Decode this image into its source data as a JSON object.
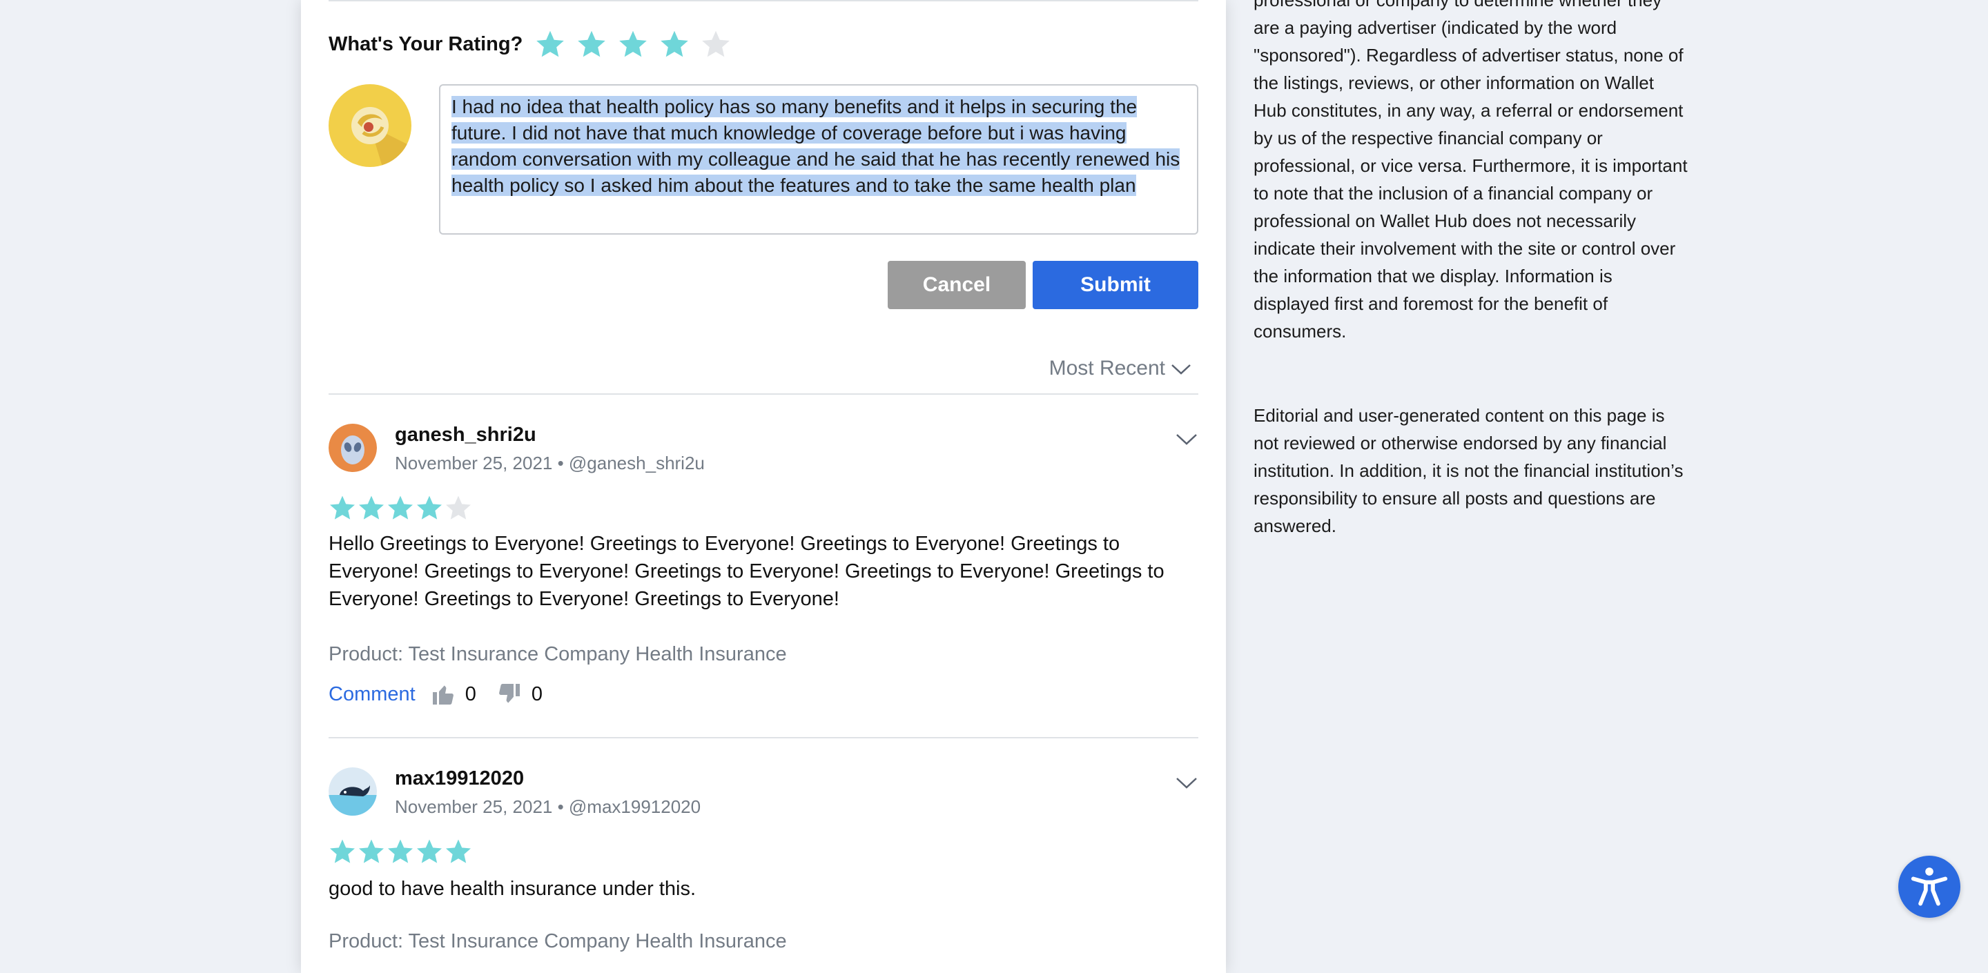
{
  "colors": {
    "star_filled": "#6fd6d9",
    "star_empty": "#e3e5e8",
    "primary": "#2b6ae0",
    "cancel": "#9c9c9c",
    "muted_text": "#737b85"
  },
  "rating_form": {
    "label": "What's Your Rating?",
    "selected_stars": 4,
    "max_stars": 5,
    "review_text": "I had no idea that health policy has so many benefits and it helps in securing the future. I did not have that much knowledge of coverage before but i was having random conversation with my colleague and he said that he has recently renewed his health policy so I asked him about the features and to take the same health plan",
    "cancel_label": "Cancel",
    "submit_label": "Submit"
  },
  "sort": {
    "label": "Most Recent"
  },
  "reviews": [
    {
      "username": "ganesh_shri2u",
      "date": "November 25, 2021",
      "handle": "@ganesh_shri2u",
      "meta": "November 25, 2021 • @ganesh_shri2u",
      "stars": 4,
      "text": "Hello Greetings to Everyone! Greetings to Everyone! Greetings to Everyone! Greetings to Everyone! Greetings to Everyone! Greetings to Everyone! Greetings to Everyone! Greetings to Everyone! Greetings to Everyone! Greetings to Everyone!",
      "product": "Product: Test Insurance Company Health Insurance",
      "comment_label": "Comment",
      "upvotes": "0",
      "downvotes": "0"
    },
    {
      "username": "max19912020",
      "date": "November 25, 2021",
      "handle": "@max19912020",
      "meta": "November 25, 2021 • @max19912020",
      "stars": 5,
      "text": "good to have health insurance under this.",
      "product": "Product: Test Insurance Company Health Insurance"
    }
  ],
  "sidebar": {
    "disclaimer_1": "professional or company to determine whether they are a paying advertiser (indicated by the word \"sponsored\"). Regardless of advertiser status, none of the listings, reviews, or other information on Wallet Hub constitutes, in any way, a referral or endorsement by us of the respective financial company or professional, or vice versa. Furthermore, it is important to note that the inclusion of a financial company or professional on Wallet Hub does not necessarily indicate their involvement with the site or control over the information that we display. Information is displayed first and foremost for the benefit of consumers.",
    "disclaimer_2": "Editorial and user-generated content on this page is not reviewed or otherwise endorsed by any financial institution. In addition, it is not the financial institution’s responsibility to ensure all posts and questions are answered."
  },
  "icons": {
    "accessibility": "accessibility-icon",
    "thumbs_up": "thumbs-up-icon",
    "thumbs_down": "thumbs-down-icon",
    "chevron": "chevron-down-icon",
    "star": "star-icon"
  }
}
